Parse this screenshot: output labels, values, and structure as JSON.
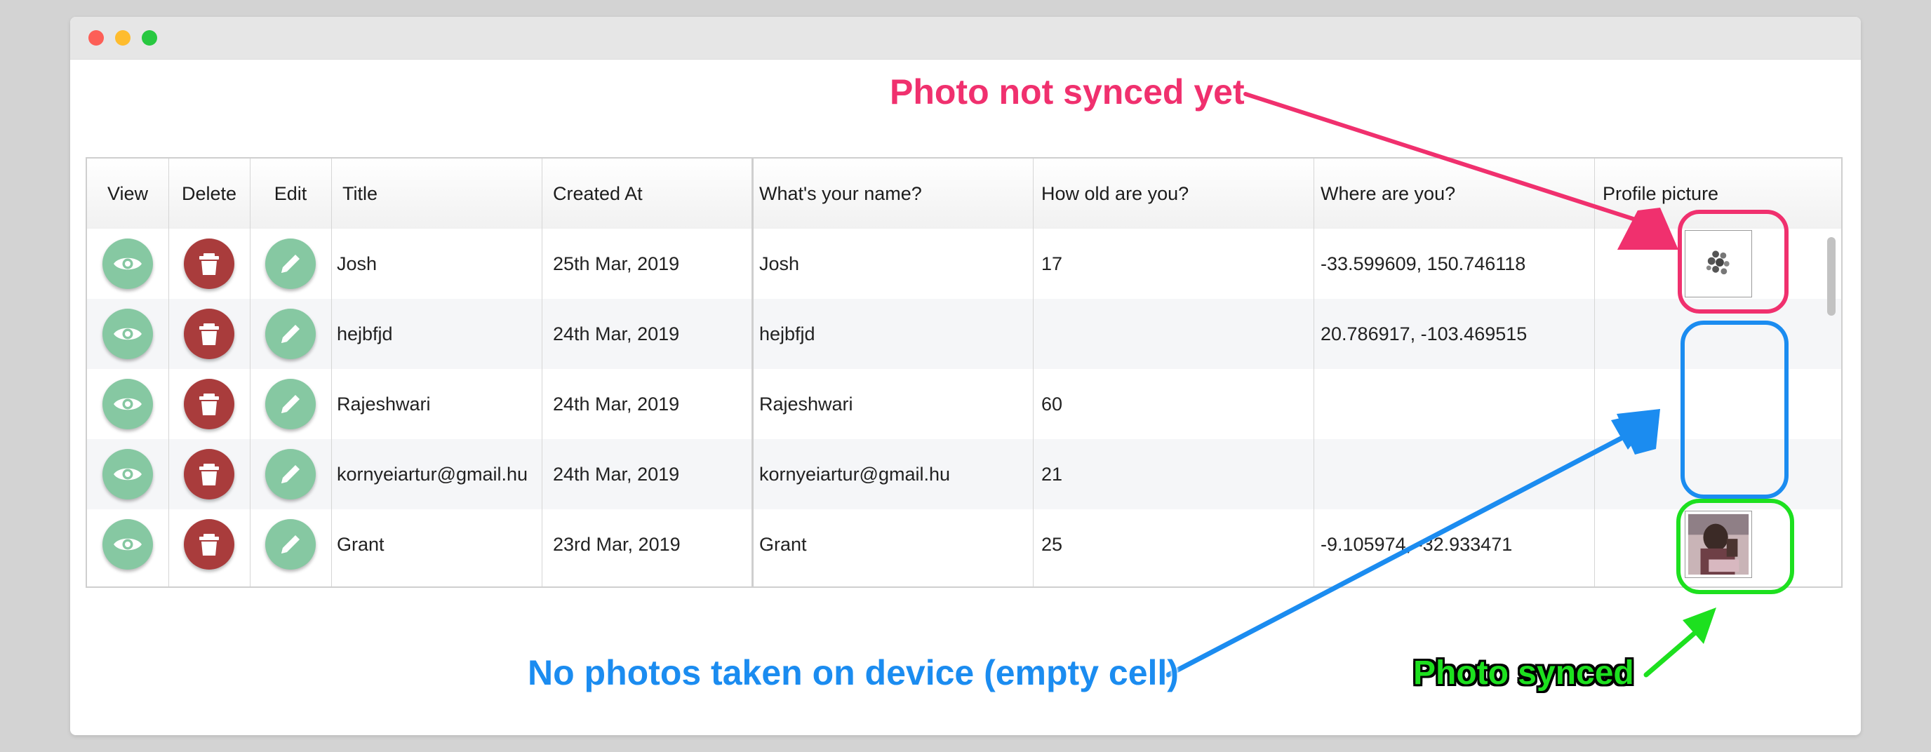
{
  "window": {
    "controls": {
      "close_color": "#fd5f57",
      "minimize_color": "#febc2e",
      "maximize_color": "#28c840"
    }
  },
  "table": {
    "headers": {
      "view": "View",
      "delete": "Delete",
      "edit": "Edit",
      "title": "Title",
      "created_at": "Created At",
      "name": "What's your name?",
      "age": "How old are you?",
      "location": "Where are you?",
      "picture": "Profile picture"
    },
    "rows": [
      {
        "title": "Josh",
        "created_at": "25th Mar, 2019",
        "name": "Josh",
        "age": "17",
        "location": "-33.599609, 150.746118",
        "picture": "loading-spinner"
      },
      {
        "title": "hejbfjd",
        "created_at": "24th Mar, 2019",
        "name": "hejbfjd",
        "age": "",
        "location": "20.786917, -103.469515",
        "picture": "empty"
      },
      {
        "title": "Rajeshwari",
        "created_at": "24th Mar, 2019",
        "name": "Rajeshwari",
        "age": "60",
        "location": "",
        "picture": "empty"
      },
      {
        "title": "kornyeiartur@gmail.hu",
        "created_at": "24th Mar, 2019",
        "name": "kornyeiartur@gmail.hu",
        "age": "21",
        "location": "",
        "picture": "empty"
      },
      {
        "title": "Grant",
        "created_at": "23rd Mar, 2019",
        "name": "Grant",
        "age": "25",
        "location": "-9.105974, -32.933471",
        "picture": "photo-thumbnail"
      }
    ],
    "action_icons": {
      "view": "eye-icon",
      "delete": "trash-icon",
      "edit": "pencil-icon"
    },
    "colors": {
      "view_button": "#86c8a2",
      "edit_button": "#86c8a2",
      "delete_button": "#a93c3c"
    }
  },
  "annotations": {
    "not_synced": {
      "text": "Photo not synced yet",
      "color": "#f0306e"
    },
    "no_photos": {
      "text": "No photos taken on device (empty cell)",
      "color": "#1b8cf0"
    },
    "synced": {
      "text": "Photo synced",
      "color": "#1de01f"
    }
  }
}
